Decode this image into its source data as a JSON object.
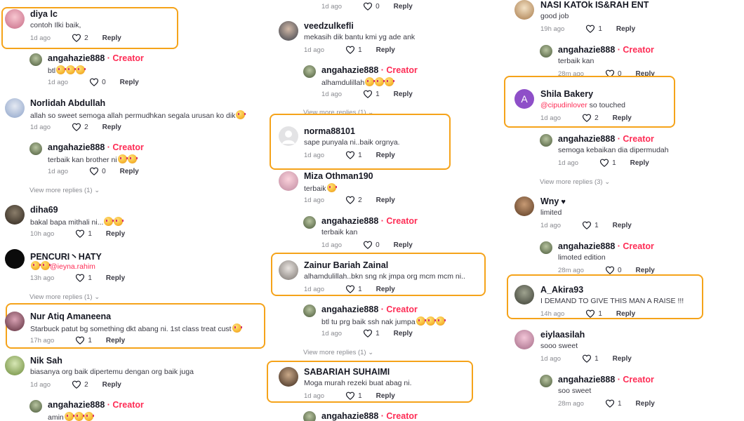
{
  "ui": {
    "reply_label": "Reply",
    "creator_tag": " · Creator",
    "heart_icon": "heart-outline-icon",
    "highlight_color": "#f5a31a",
    "creator_color": "#fe2c55"
  },
  "col1": {
    "c1": {
      "name": "diya lc",
      "text": "contoh Ilki baik,",
      "time": "1d ago",
      "likes": "2"
    },
    "r1": {
      "name": "angahazie888",
      "text": "btl",
      "time": "1d ago",
      "likes": "0"
    },
    "c2": {
      "name": "Norlidah Abdullah",
      "text": "allah so sweet semoga allah permudhkan segala urusan ko dik",
      "time": "1d ago",
      "likes": "2"
    },
    "r2": {
      "name": "angahazie888",
      "text": "terbaik kan brother ni",
      "time": "1d ago",
      "likes": "0"
    },
    "vm1": "View more replies (1)",
    "c3": {
      "name": "diha69",
      "text": "bakal bapa mithali ni...",
      "time": "10h ago",
      "likes": "1"
    },
    "c4": {
      "name": "PENCURI丶HATY",
      "mention": "@ieyna.rahim",
      "time": "13h ago",
      "likes": "1"
    },
    "vm2": "View more replies (1)",
    "c5": {
      "name": "Nur Atiq Amaneena",
      "text": "Starbuck patut bg something dkt abang ni. 1st class treat cust",
      "time": "17h ago",
      "likes": "1"
    },
    "c6": {
      "name": "Nik Sah",
      "text": "biasanya org baik dipertemu dengan org baik juga",
      "time": "1d ago",
      "likes": "2"
    },
    "r3": {
      "name": "angahazie888",
      "text": "amin"
    }
  },
  "col2": {
    "top": {
      "time": "1d ago",
      "likes": "0"
    },
    "c1": {
      "name": "veedzulkefli",
      "text": "mekasih dik bantu kmi yg ade ank",
      "time": "1d ago",
      "likes": "1"
    },
    "r1": {
      "name": "angahazie888",
      "text": "alhamdulillah",
      "time": "1d ago",
      "likes": "1"
    },
    "vm1": "View more replies (1)",
    "c2": {
      "name": "norma88101",
      "text": "sape punyala ni..baik orgnya.",
      "time": "1d ago",
      "likes": "1"
    },
    "c3": {
      "name": "Miza Othman190",
      "text": "terbaik",
      "time": "1d ago",
      "likes": "2"
    },
    "r2": {
      "name": "angahazie888",
      "text": "terbaik kan",
      "time": "1d ago",
      "likes": "0"
    },
    "c4": {
      "name": "Zainur Bariah Zainal",
      "text": "alhamdulillah..bkn sng nk jmpa org mcm mcm ni..",
      "time": "1d ago",
      "likes": "1"
    },
    "r3": {
      "name": "angahazie888",
      "text": "btl tu prg baik ssh nak jumpa",
      "time": "1d ago",
      "likes": "1"
    },
    "vm2": "View more replies (1)",
    "c5": {
      "name": "SABARIAH SUHAIMI",
      "text": "Moga murah rezeki buat abag ni.",
      "time": "1d ago",
      "likes": "1"
    },
    "r4": {
      "name": "angahazie888"
    }
  },
  "col3": {
    "c1": {
      "name": "NASI KATOk IS&RAH ENT",
      "text": "good job",
      "time": "19h ago",
      "likes": "1"
    },
    "r1": {
      "name": "angahazie888",
      "text": "terbaik kan",
      "time": "28m ago",
      "likes": "0"
    },
    "c2": {
      "name": "Shila Bakery",
      "avatar_letter": "A",
      "mention": "@cipudinlover",
      "text": " so touched",
      "time": "1d ago",
      "likes": "2"
    },
    "r2": {
      "name": "angahazie888",
      "text": "semoga kebaikan dia dipermudah",
      "time": "1d ago",
      "likes": "1"
    },
    "vm1": "View more replies (3)",
    "c3": {
      "name": "Wny",
      "text": "limited",
      "time": "1d ago",
      "likes": "1"
    },
    "r3": {
      "name": "angahazie888",
      "text": "limoted edition",
      "time": "28m ago",
      "likes": "0"
    },
    "c4": {
      "name": "A_Akira93",
      "text": "I DEMAND TO GIVE THIS MAN A RAISE !!!",
      "time": "14h ago",
      "likes": "1"
    },
    "c5": {
      "name": "eiylaasilah",
      "text": "sooo sweet",
      "time": "1d ago",
      "likes": "1"
    },
    "r4": {
      "name": "angahazie888",
      "text": "soo sweet",
      "time": "28m ago",
      "likes": "1"
    }
  }
}
